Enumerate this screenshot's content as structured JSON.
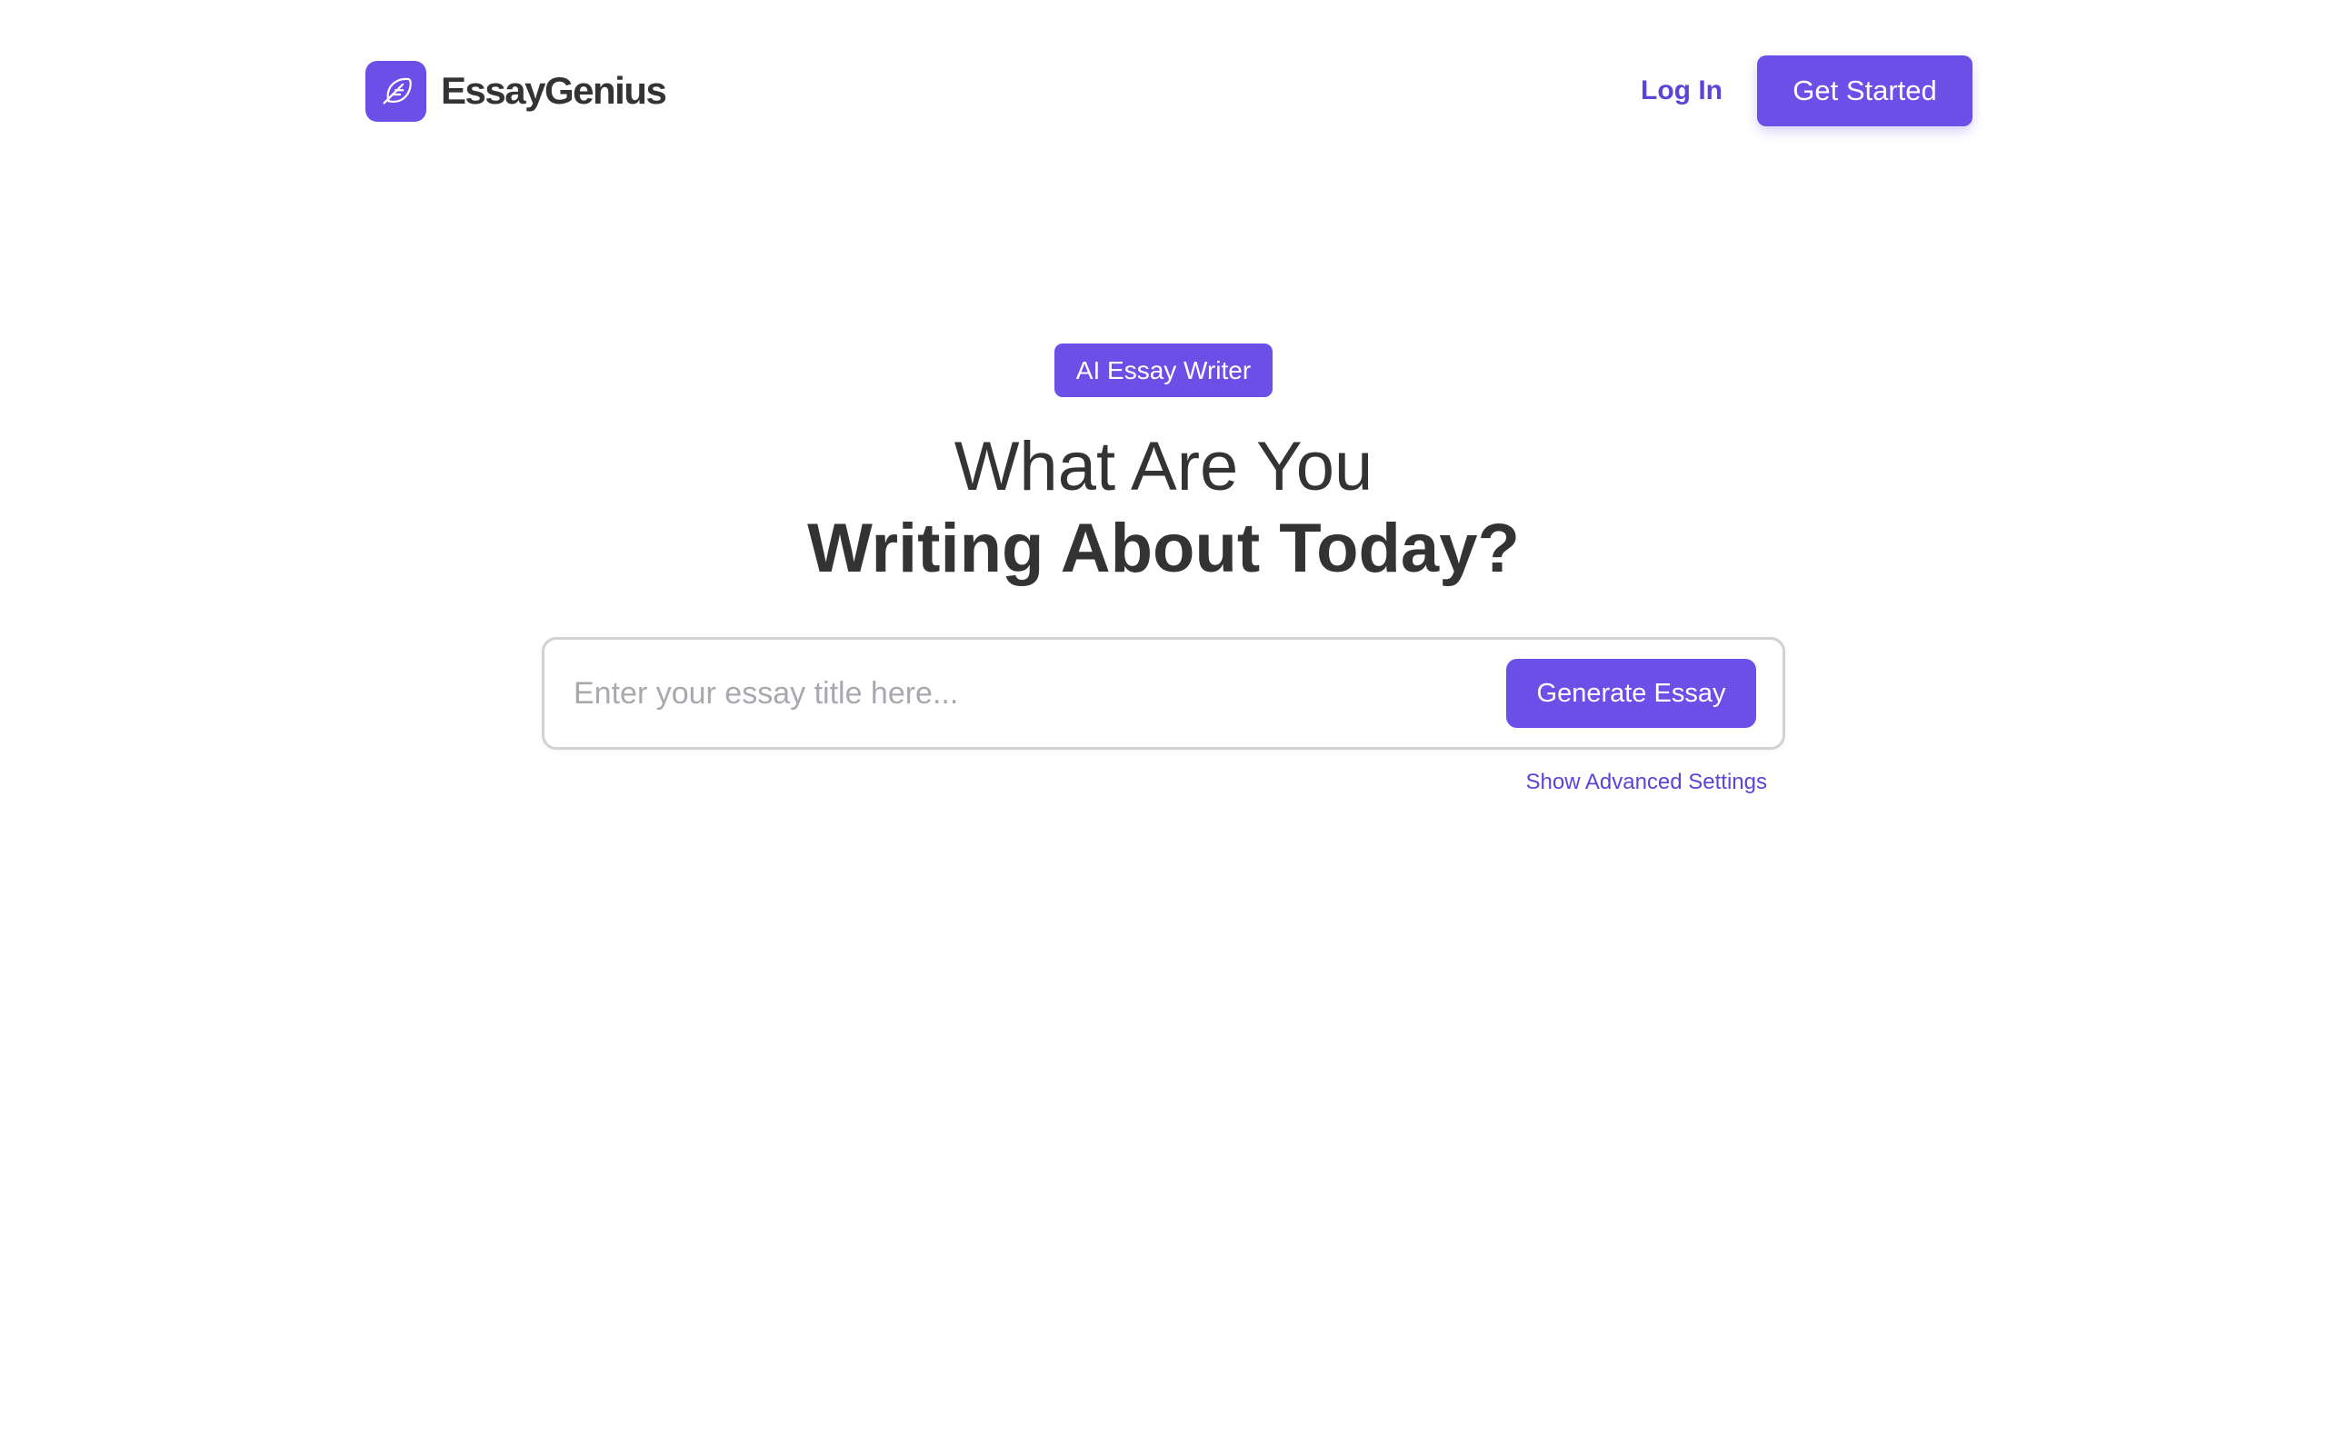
{
  "brand": {
    "name": "EssayGenius",
    "logo_icon": "feather-icon",
    "accent_color": "#6b4fe6"
  },
  "nav": {
    "login_label": "Log In",
    "get_started_label": "Get Started"
  },
  "hero": {
    "badge_label": "AI Essay Writer",
    "headline_line1": "What Are You",
    "headline_line2": "Writing About Today?",
    "input_placeholder": "Enter your essay title here...",
    "input_value": "",
    "generate_label": "Generate Essay",
    "advanced_settings_label": "Show Advanced Settings"
  }
}
